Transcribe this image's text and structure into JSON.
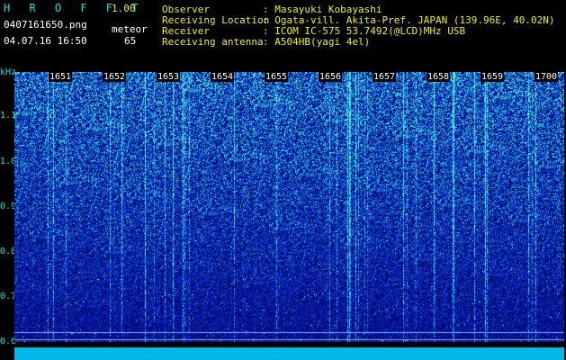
{
  "app": {
    "title": "H R O F F T",
    "version": "1.00",
    "filename": "0407161650.png",
    "datetime": "04.07.16 16:50",
    "mode_label": "meteor",
    "count": "65"
  },
  "info": [
    {
      "label": "Observer",
      "value": ": Masayuki Kobayashi"
    },
    {
      "label": "Receiving Location",
      "value": ": Ogata-vill. Akita-Pref. JAPAN (139.96E, 40.02N)"
    },
    {
      "label": "Receiver",
      "value": ": ICOM IC-575 53.7492(@LCD)MHz USB"
    },
    {
      "label": "Receiving antenna",
      "value": ": A504HB(yagi 4el)"
    }
  ],
  "spectrogram": {
    "y_unit": "kHz",
    "y_ticks": [
      "1.1",
      "1.0",
      "0.9",
      "0.8",
      "0.7",
      "0.6"
    ],
    "x_ticks": [
      "1651",
      "1652",
      "1653",
      "1654",
      "1655",
      "1656",
      "1657",
      "1658",
      "1659",
      "1700"
    ],
    "colors": {
      "background": "#000000",
      "label": "#00e5e5",
      "accent": "#f0f000",
      "baseline": "#00b9e6"
    }
  }
}
